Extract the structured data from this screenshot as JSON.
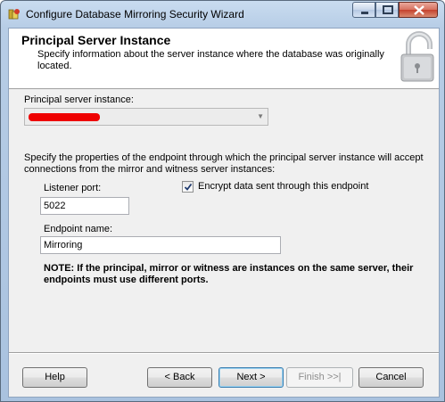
{
  "window": {
    "title": "Configure Database Mirroring Security Wizard"
  },
  "header": {
    "title": "Principal Server Instance",
    "subtitle": "Specify information about the server instance where the database was originally located."
  },
  "principal": {
    "label": "Principal server instance:",
    "value": ""
  },
  "endpoint_description": "Specify the properties of the endpoint through which the principal server instance will accept connections from the mirror and witness server instances:",
  "listener_port": {
    "label": "Listener port:",
    "value": "5022"
  },
  "encrypt": {
    "label": "Encrypt data sent through this endpoint",
    "checked": true
  },
  "endpoint_name": {
    "label": "Endpoint name:",
    "value": "Mirroring"
  },
  "note": "NOTE: If the principal, mirror or witness are instances on the same server, their endpoints must use different ports.",
  "buttons": {
    "help": "Help",
    "back": "< Back",
    "next": "Next >",
    "finish": "Finish >>|",
    "cancel": "Cancel"
  }
}
